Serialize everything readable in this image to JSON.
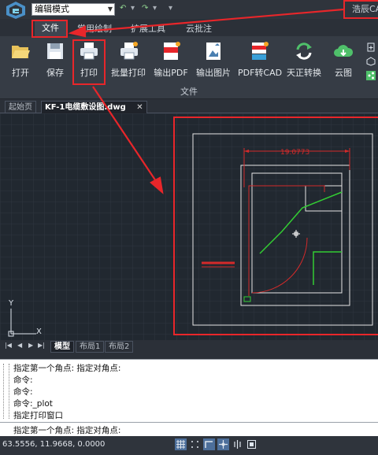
{
  "window": {
    "brand": "浩辰CAD"
  },
  "quick_access": {
    "mode_select_value": "编辑模式",
    "undo_glyph": "↶",
    "redo_glyph": "↷",
    "more_glyph": "▾"
  },
  "ribbon_tabs": [
    {
      "label": "文件",
      "active": true
    },
    {
      "label": "常用绘制"
    },
    {
      "label": "扩展工具"
    },
    {
      "label": "云批注"
    }
  ],
  "ribbon": {
    "group_label": "文件",
    "tools": [
      {
        "label": "打开",
        "icon": "folder-open-icon"
      },
      {
        "label": "保存",
        "icon": "save-icon"
      },
      {
        "label": "打印",
        "icon": "printer-icon"
      },
      {
        "label": "批量打印",
        "icon": "batch-print-icon"
      },
      {
        "label": "输出PDF",
        "icon": "pdf-export-icon"
      },
      {
        "label": "输出图片",
        "icon": "image-export-icon"
      },
      {
        "label": "PDF转CAD",
        "icon": "pdf-to-cad-icon"
      },
      {
        "label": "天正转换",
        "icon": "convert-icon"
      },
      {
        "label": "云图",
        "icon": "cloud-icon"
      }
    ]
  },
  "doc_tabs": [
    {
      "label": "起始页"
    },
    {
      "label": "KF-1电缆敷设图.dwg",
      "active": true,
      "close": "✕"
    }
  ],
  "drawing": {
    "dimension_text": "19.0773",
    "axis_y": "Y",
    "axis_x": "X"
  },
  "layout_tabs": [
    {
      "label": "模型",
      "active": true
    },
    {
      "label": "布局1"
    },
    {
      "label": "布局2"
    }
  ],
  "layout_nav": [
    "|◀",
    "◀",
    "▶",
    "▶|"
  ],
  "command_history": [
    "指定第一个角点: 指定对角点:",
    "命令:",
    "命令:",
    "命令:_plot",
    "指定打印窗口",
    ""
  ],
  "command_input": "指定第一个角点: 指定对角点:",
  "status": {
    "coordinates": "63.5556, 11.9668, 0.0000"
  },
  "colors": {
    "highlight": "#e8262a",
    "canvas": "#212830",
    "geometry_green": "#33cc33",
    "geometry_red": "#d42a2a"
  }
}
